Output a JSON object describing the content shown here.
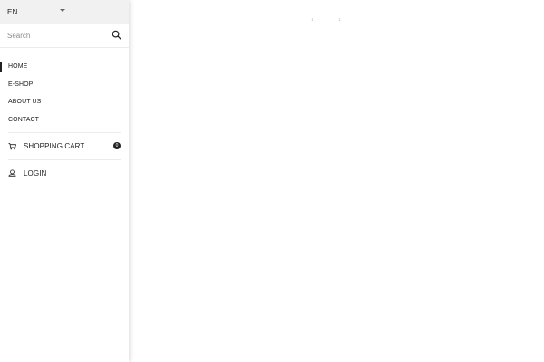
{
  "language": {
    "selected": "EN"
  },
  "search": {
    "placeholder": "Search"
  },
  "nav": {
    "items": [
      {
        "label": "HOME"
      },
      {
        "label": "E-SHOP"
      },
      {
        "label": "ABOUT US"
      },
      {
        "label": "CONTACT"
      }
    ]
  },
  "cart": {
    "label": "SHOPPING CART",
    "count": "0"
  },
  "login": {
    "label": "LOGIN"
  },
  "main": {
    "mark_a": "↕",
    "mark_b": "↕"
  },
  "icons": {
    "search": "search-icon",
    "cart": "shopping-cart-icon",
    "login": "user-icon",
    "caret": "chevron-down-icon"
  },
  "colors": {
    "text": "#222222",
    "muted": "#8a8a8a",
    "lang_bar_bg": "#f1f1f1",
    "divider": "#ececec",
    "badge_bg": "#222222"
  }
}
